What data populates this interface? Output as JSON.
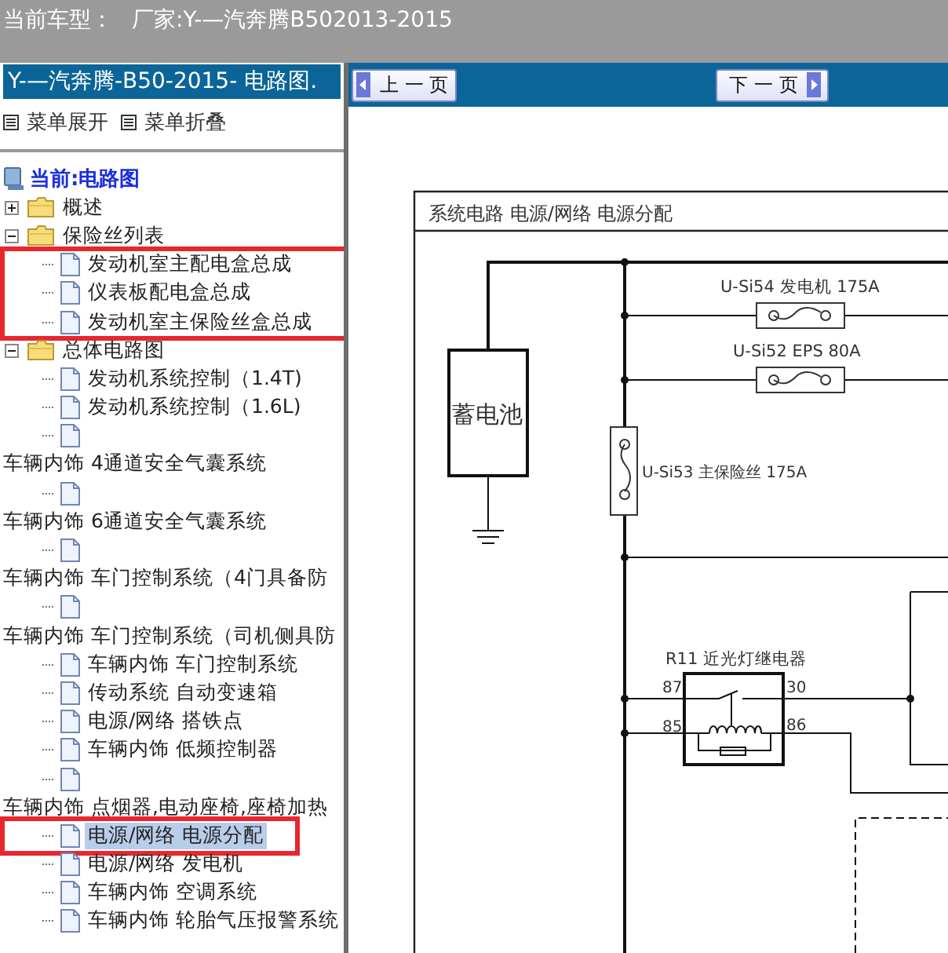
{
  "header": {
    "label": "当前车型：",
    "value": "厂家:Y-—汽奔腾B502013-2015"
  },
  "sidebar": {
    "title": "Y-—汽奔腾-B50-2015- 电路图.",
    "actions": [
      "菜单展开",
      "菜单折叠"
    ],
    "root": "当前:电路图",
    "tree": [
      {
        "kind": "folder",
        "label": "概述",
        "expanded": false
      },
      {
        "kind": "folder",
        "label": "保险丝列表",
        "expanded": true,
        "children": [
          {
            "kind": "doc",
            "label": "发动机室主配电盒总成",
            "selected": false,
            "boxed": true
          },
          {
            "kind": "doc",
            "label": "仪表板配电盒总成",
            "selected": false,
            "boxed": true
          },
          {
            "kind": "doc",
            "label": "发动机室主保险丝盒总成",
            "selected": false,
            "boxed": true
          }
        ]
      },
      {
        "kind": "folder",
        "label": "总体电路图",
        "expanded": true,
        "children": [
          {
            "kind": "doc",
            "label": "发动机系统控制（1.4T)",
            "selected": false,
            "boxed": false
          },
          {
            "kind": "doc",
            "label": "发动机系统控制（1.6L)",
            "selected": false,
            "boxed": false
          },
          {
            "kind": "doc",
            "selected": false,
            "boxed": false
          }
        ]
      },
      {
        "kind": "group",
        "label": "车辆内饰 4通道安全气囊系统",
        "children": [
          {
            "kind": "doc",
            "selected": false,
            "boxed": false
          }
        ]
      },
      {
        "kind": "group",
        "label": "车辆内饰 6通道安全气囊系统",
        "children": [
          {
            "kind": "doc",
            "selected": false,
            "boxed": false
          }
        ]
      },
      {
        "kind": "group",
        "label": "车辆内饰 车门控制系统（4门具备防",
        "children": [
          {
            "kind": "doc",
            "selected": false,
            "boxed": false
          }
        ]
      },
      {
        "kind": "group",
        "label": "车辆内饰 车门控制系统（司机侧具防",
        "children": [
          {
            "kind": "doc",
            "label": "车辆内饰 车门控制系统",
            "selected": false,
            "boxed": false
          },
          {
            "kind": "doc",
            "label": "传动系统 自动变速箱",
            "selected": false,
            "boxed": false
          },
          {
            "kind": "doc",
            "label": "电源/网络 搭铁点",
            "selected": false,
            "boxed": false
          },
          {
            "kind": "doc",
            "label": "车辆内饰 低频控制器",
            "selected": false,
            "boxed": false
          },
          {
            "kind": "doc",
            "selected": false,
            "boxed": false
          }
        ]
      },
      {
        "kind": "group",
        "label": "车辆内饰 点烟器,电动座椅,座椅加热",
        "children": [
          {
            "kind": "doc",
            "label": "电源/网络 电源分配",
            "selected": true,
            "boxed": true
          },
          {
            "kind": "doc",
            "label": "电源/网络 发电机",
            "selected": false,
            "boxed": false
          },
          {
            "kind": "doc",
            "label": "车辆内饰 空调系统",
            "selected": false,
            "boxed": false
          },
          {
            "kind": "doc",
            "label": "车辆内饰 轮胎气压报警系统",
            "selected": false,
            "boxed": false
          }
        ]
      }
    ]
  },
  "toolbar": {
    "prev": "上 一 页",
    "next": "下 一 页"
  },
  "diagram": {
    "title": "系统电路  电源/网络  电源分配",
    "battery": "蓄电池",
    "fuses": [
      {
        "label": "U-Si54 发电机 175A"
      },
      {
        "label": "U-Si52  EPS  80A"
      },
      {
        "label": "U-Si53  主保险丝 175A"
      }
    ],
    "relay": {
      "label": "R11  近光灯继电器",
      "pins": [
        "87",
        "30",
        "85",
        "86"
      ]
    }
  }
}
